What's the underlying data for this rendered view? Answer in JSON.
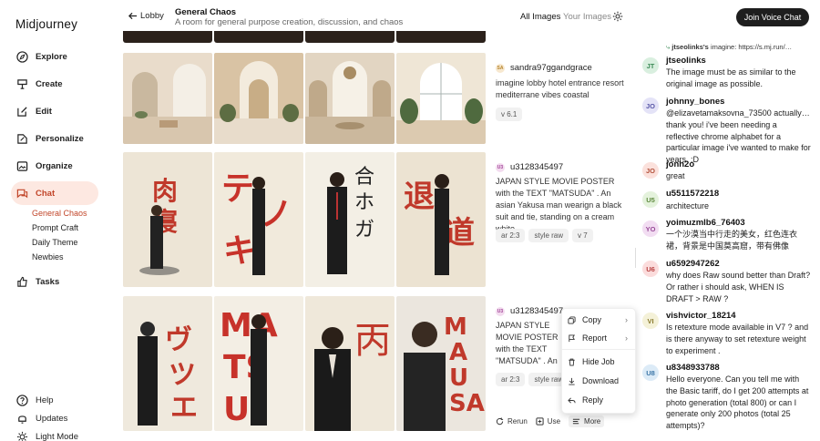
{
  "app": {
    "logo": "Midjourney"
  },
  "nav": [
    {
      "label": "Explore",
      "icon": "compass-icon"
    },
    {
      "label": "Create",
      "icon": "brush-icon"
    },
    {
      "label": "Edit",
      "icon": "edit-icon"
    },
    {
      "label": "Personalize",
      "icon": "personalize-icon"
    },
    {
      "label": "Organize",
      "icon": "image-icon"
    },
    {
      "label": "Chat",
      "icon": "chat-icon",
      "active": true
    },
    {
      "label": "Tasks",
      "icon": "thumbs-up-icon"
    }
  ],
  "chat_channels": [
    "General Chaos",
    "Prompt Craft",
    "Daily Theme",
    "Newbies"
  ],
  "bottom_nav": [
    {
      "label": "Help",
      "icon": "help-icon"
    },
    {
      "label": "Updates",
      "icon": "bell-icon"
    },
    {
      "label": "Light Mode",
      "icon": "sun-icon"
    }
  ],
  "header": {
    "back_label": "Lobby",
    "channel_title": "General Chaos",
    "channel_subtitle": "A room for general purpose creation, discussion, and chaos",
    "tab_all": "All Images",
    "tab_yours": "Your Images",
    "join_voice": "Join Voice Chat"
  },
  "jobs": [
    {
      "avatar": "SA",
      "user": "sandra97ggandgrace",
      "prompt": "imagine lobby hotel entrance resort mediterrane vibes coastal",
      "chips": [
        "v 6.1"
      ]
    },
    {
      "avatar": "U3",
      "user": "u3128345497",
      "prompt": "JAPAN STYLE MOVIE POSTER with the TEXT \"MATSUDA\" . An asian Yakusa man wearign a black suit and tie, standing on a cream white…",
      "chips": [
        "ar 2:3",
        "style raw",
        "v 7"
      ]
    },
    {
      "avatar": "U3",
      "user": "u3128345497",
      "prompt": "JAPAN STYLE MOVIE POSTER with the TEXT \"MATSUDA\" . An asian Yakusa man wearign a black suit and tie, standing on a cream white…",
      "chips": [
        "ar 2:3",
        "style raw"
      ]
    }
  ],
  "poster_text": {
    "caption": "MATSUDA"
  },
  "actions": {
    "rerun": "Rerun",
    "use": "Use",
    "more": "More"
  },
  "context_menu": [
    "Copy",
    "Report",
    "Hide Job",
    "Download",
    "Reply"
  ],
  "chat": {
    "reply_context_user": "jtseolinks's",
    "reply_context_text": "imagine: https://s.mj.run/…",
    "messages": [
      {
        "avatar": "JT",
        "color": "#d9efdf",
        "fg": "#3c8a56",
        "user": "jtseolinks",
        "text": "The image must be as similar to the original image as possible."
      },
      {
        "avatar": "JO",
        "color": "#e4e3f7",
        "fg": "#5a58a8",
        "user": "johnny_bones",
        "text": "@elizavetamaksovna_73500 actually… thank you! i've been needing a reflective chrome alphabet for a particular image i've wanted to make for years. :D"
      },
      {
        "avatar": "JO",
        "color": "#fbe1dc",
        "fg": "#b2503b",
        "user": "jonh2o",
        "text": "great"
      },
      {
        "avatar": "U5",
        "color": "#e4f2dc",
        "fg": "#5f8a3f",
        "user": "u5511572218",
        "text": "architecture"
      },
      {
        "avatar": "YO",
        "color": "#f2ddf2",
        "fg": "#984a98",
        "user": "yoimuzmlb6_76403",
        "text": "一个沙漠当中行走的美女，红色连衣裙，背景是中国莫高窟，带有佛像"
      },
      {
        "avatar": "U6",
        "color": "#fbdcdc",
        "fg": "#b84040",
        "user": "u6592947262",
        "text": "why does Raw sound better than Draft? Or rather i should ask, WHEN IS DRAFT > RAW ?"
      },
      {
        "avatar": "VI",
        "color": "#f4f1d8",
        "fg": "#8a7b2e",
        "user": "vishvictor_18214",
        "text": "Is retexture mode available in V7 ? and is there anyway to set retexture weight to experiment ."
      },
      {
        "avatar": "U8",
        "color": "#dcebf7",
        "fg": "#3d77a8",
        "user": "u8348933788",
        "text": "Hello everyone. Can you tell me with the Basic tariff, do I get 200 attempts at photo generation (total 800) or can I generate only 200 photos (total 25 attempts)?"
      }
    ]
  }
}
